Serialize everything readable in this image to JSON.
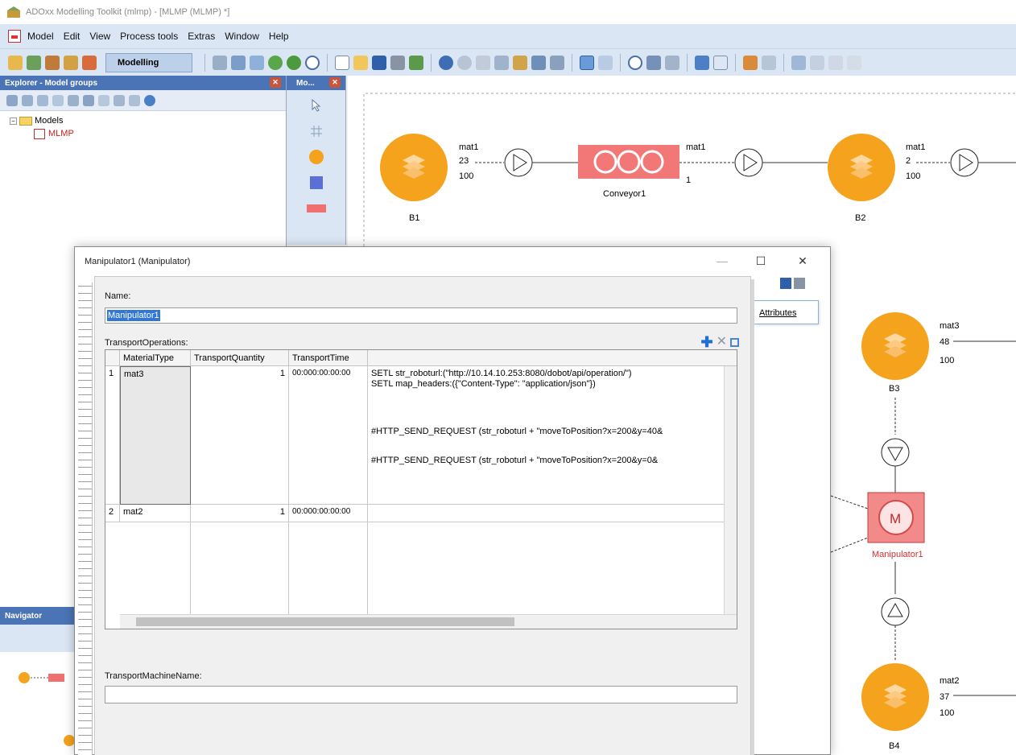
{
  "window": {
    "title": "ADOxx Modelling Toolkit (mlmp) - [MLMP (MLMP) *]"
  },
  "menu": [
    "Model",
    "Edit",
    "View",
    "Process tools",
    "Extras",
    "Window",
    "Help"
  ],
  "toolbar": {
    "mode": "Modelling"
  },
  "explorer": {
    "title": "Explorer - Model groups",
    "tree_root": "Models",
    "tree_child": "MLMP"
  },
  "modelbar": {
    "title": "Mo..."
  },
  "navigator": {
    "title": "Navigator"
  },
  "canvas": {
    "nodes": [
      {
        "id": "B1",
        "material": "mat1",
        "count": "23",
        "capacity": "100"
      },
      {
        "id": "B2",
        "material": "mat1",
        "count": "2",
        "capacity": "100"
      },
      {
        "id": "B3",
        "material": "mat3",
        "count": "48",
        "capacity": "100"
      },
      {
        "id": "B4",
        "material": "mat2",
        "count": "37",
        "capacity": "100"
      }
    ],
    "conveyor": {
      "label": "Conveyor1",
      "material": "mat1",
      "count": "1"
    },
    "manipulator": {
      "label": "Manipulator1",
      "letter": "M"
    }
  },
  "dialog": {
    "title": "Manipulator1 (Manipulator)",
    "name_label": "Name:",
    "name_value": "Manipulator1",
    "attributes_tab": "Attributes",
    "transport_ops_label": "TransportOperations:",
    "columns": [
      "MaterialType",
      "TransportQuantity",
      "TransportTime"
    ],
    "rows": [
      {
        "index": "1",
        "material": "mat3",
        "quantity": "1",
        "time": "00:000:00:00:00",
        "code": [
          "SETL str_roboturl:(\"http://10.14.10.253:8080/dobot/api/operation/\")",
          "SETL map_headers:({\"Content-Type\": \"application/json\"})",
          "",
          "",
          "#HTTP_SEND_REQUEST (str_roboturl + \"moveToPosition?x=200&y=40&",
          "",
          "#HTTP_SEND_REQUEST (str_roboturl + \"moveToPosition?x=200&y=0&"
        ]
      },
      {
        "index": "2",
        "material": "mat2",
        "quantity": "1",
        "time": "00:000:00:00:00",
        "code": []
      }
    ],
    "machine_name_label": "TransportMachineName:",
    "machine_name_value": ""
  }
}
